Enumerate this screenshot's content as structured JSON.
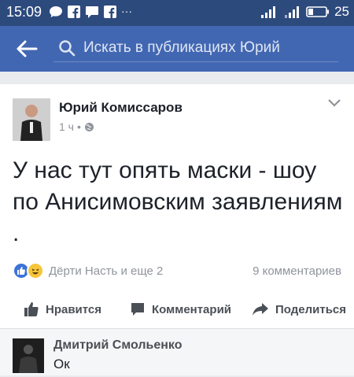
{
  "status_bar": {
    "time": "15:09",
    "battery": "25"
  },
  "search": {
    "placeholder": "Искать в публикациях Юрий"
  },
  "post": {
    "author": "Юрий Комиссаров",
    "time": "1 ч",
    "separator": "•",
    "text": "У нас тут опять маски - шоу по Анисимовским заявлениям .",
    "reactions_label": "Дёрти Насть и еще 2",
    "comments_count": "9 комментариев"
  },
  "actions": {
    "like": "Нравится",
    "comment": "Комментарий",
    "share": "Поделиться"
  },
  "comment": {
    "author": "Дмитрий Смольенко",
    "text": "Ок"
  },
  "colors": {
    "appbar": "#4267b2",
    "statusbar": "#2d4a7d",
    "like_blue": "#3b73d9",
    "haha_yellow": "#f7c53a"
  }
}
